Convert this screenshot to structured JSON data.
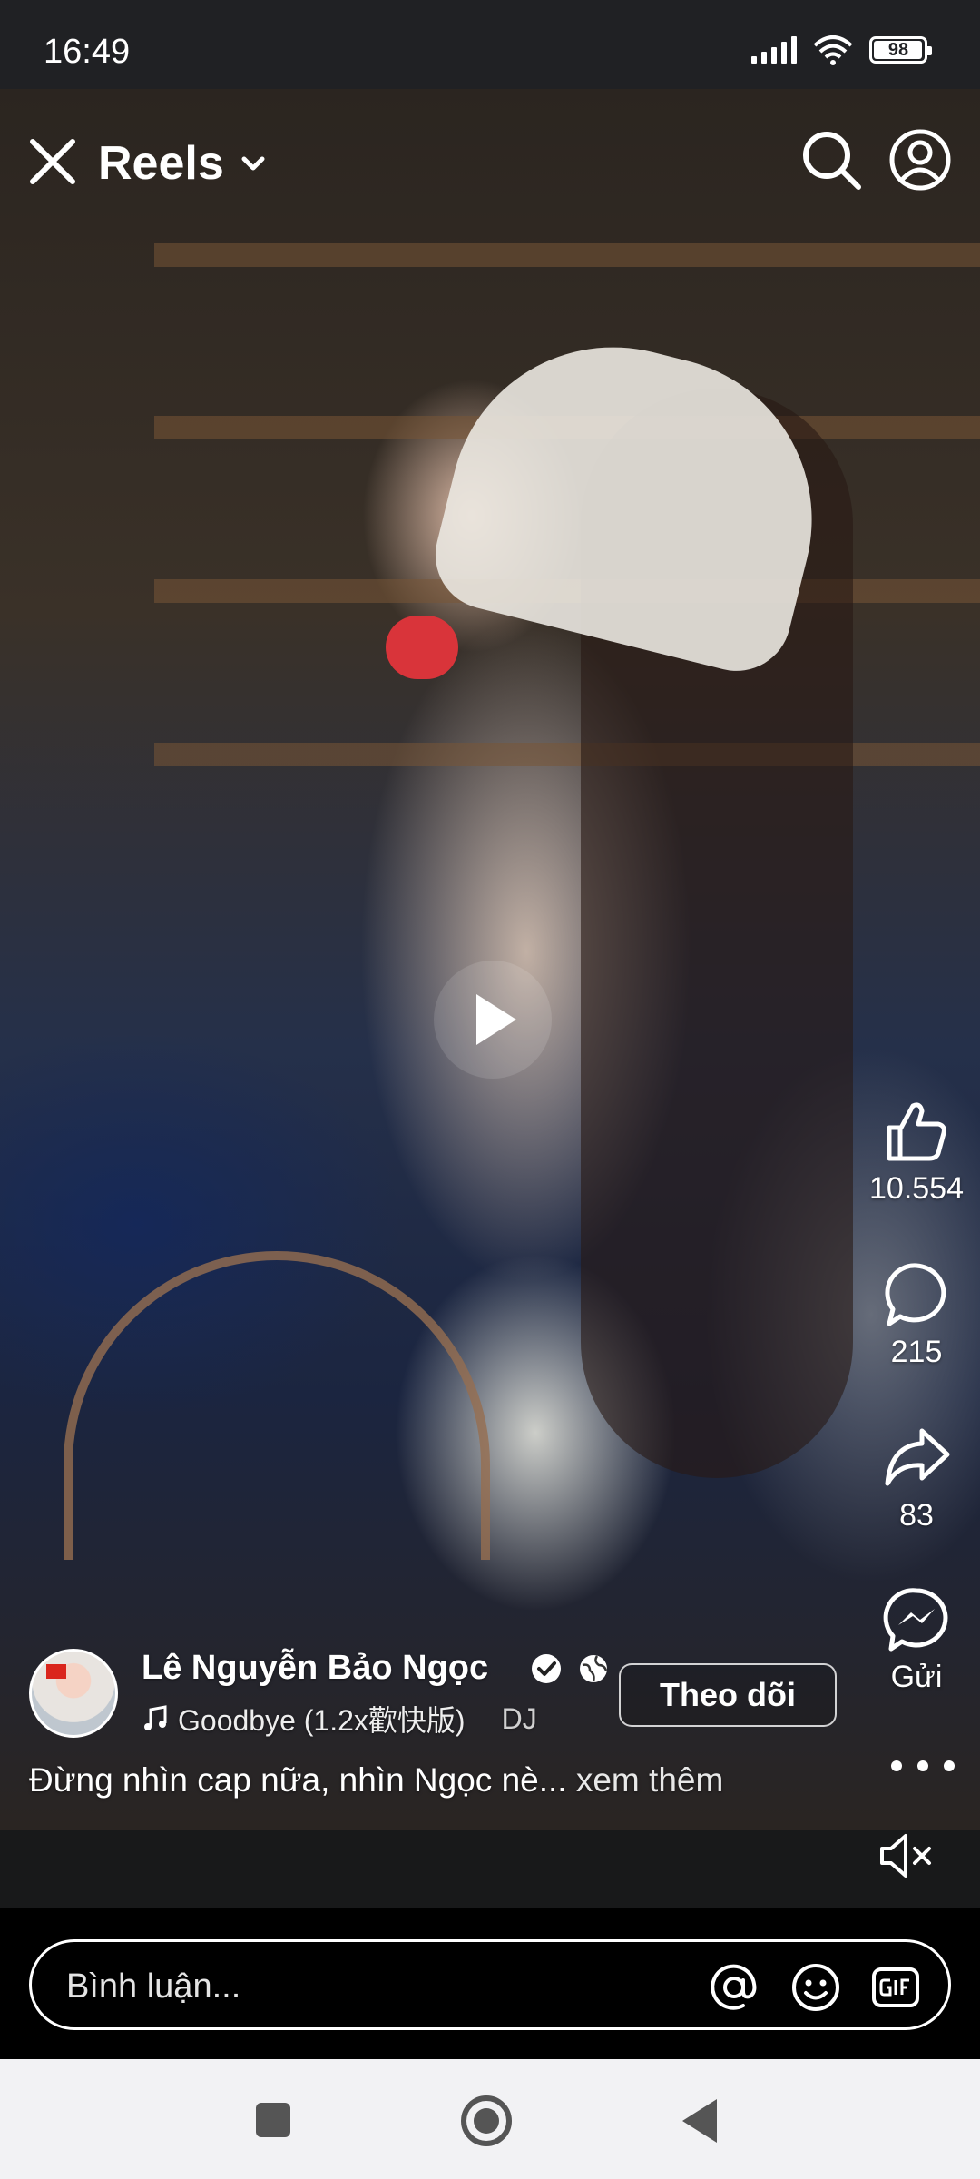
{
  "status_bar": {
    "time": "16:49",
    "battery": "98",
    "battery_level_percent": 98,
    "icons": [
      "signal-icon",
      "wifi-icon",
      "battery-icon"
    ]
  },
  "header": {
    "title": "Reels",
    "icons": [
      "close-icon",
      "chevron-down-icon",
      "search-icon",
      "profile-icon"
    ]
  },
  "actions": {
    "like_count": "10.554",
    "comment_count": "215",
    "share_count": "83",
    "send_label": "Gửi"
  },
  "post": {
    "author_name": "Lê Nguyễn Bảo Ngọc",
    "music_track": "Goodbye (1.2x歡快版)",
    "music_artist": "DJ",
    "follow_label": "Theo dõi",
    "caption": "Đừng nhìn cap nữa, nhìn Ngọc nè...",
    "see_more": "xem thêm"
  },
  "comment_bar": {
    "placeholder": "Bình luận..."
  },
  "colors": {
    "status_bar_bg": "#202124",
    "app_bg": "#18191a",
    "nav_bar_bg": "#f2f2f4"
  }
}
